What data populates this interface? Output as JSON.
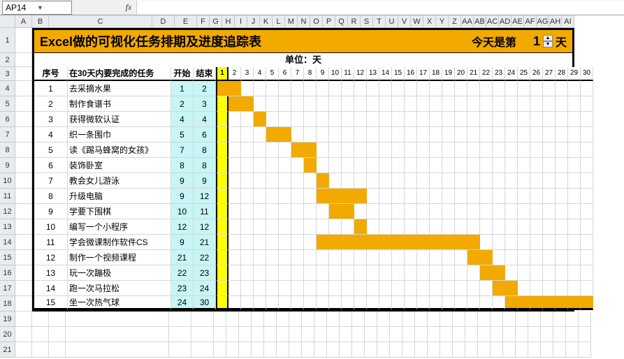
{
  "namebox": "AP14",
  "fx_label": "fx",
  "col_headers": [
    "A",
    "B",
    "C",
    "D",
    "E",
    "F",
    "G",
    "H",
    "I",
    "J",
    "K",
    "L",
    "M",
    "N",
    "O",
    "P",
    "Q",
    "R",
    "S",
    "T",
    "U",
    "V",
    "W",
    "X",
    "Y",
    "Z",
    "AA",
    "AB",
    "AC",
    "AD",
    "AE",
    "AF",
    "AG",
    "AH",
    "AI"
  ],
  "row_headers": [
    "1",
    "2",
    "3",
    "4",
    "5",
    "6",
    "7",
    "8",
    "9",
    "10",
    "11",
    "12",
    "13",
    "14",
    "15",
    "16",
    "17",
    "18",
    "19",
    "20",
    "21"
  ],
  "title": "Excel做的可视化任务排期及进度追踪表",
  "today_label": "今天是第",
  "today_value": "1",
  "today_unit": "天",
  "unit_label": "单位：天",
  "headers": {
    "seq": "序号",
    "task": "在30天内要完成的任务",
    "start": "开始",
    "end": "结束"
  },
  "days": [
    "1",
    "2",
    "3",
    "4",
    "5",
    "6",
    "7",
    "8",
    "9",
    "10",
    "11",
    "12",
    "13",
    "14",
    "15",
    "16",
    "17",
    "18",
    "19",
    "20",
    "21",
    "22",
    "23",
    "24",
    "25",
    "26",
    "27",
    "28",
    "29",
    "30"
  ],
  "today_col": 1,
  "chart_data": {
    "type": "bar",
    "title": "Excel做的可视化任务排期及进度追踪表",
    "xlabel": "天",
    "ylabel": "任务",
    "series": [
      {
        "seq": "1",
        "name": "去采摘水果",
        "start": 1,
        "end": 2
      },
      {
        "seq": "2",
        "name": "制作食谱书",
        "start": 2,
        "end": 3
      },
      {
        "seq": "3",
        "name": "获得微软认证",
        "start": 4,
        "end": 4
      },
      {
        "seq": "4",
        "name": "织一条围巾",
        "start": 5,
        "end": 6
      },
      {
        "seq": "5",
        "name": "读《踢马蜂窝的女孩》",
        "start": 7,
        "end": 8
      },
      {
        "seq": "6",
        "name": "装饰卧室",
        "start": 8,
        "end": 8
      },
      {
        "seq": "7",
        "name": "教会女儿游泳",
        "start": 9,
        "end": 9
      },
      {
        "seq": "8",
        "name": "升级电脑",
        "start": 9,
        "end": 12
      },
      {
        "seq": "9",
        "name": "学要下围棋",
        "start": 10,
        "end": 11
      },
      {
        "seq": "10",
        "name": "编写一个小程序",
        "start": 12,
        "end": 12
      },
      {
        "seq": "11",
        "name": "学会微课制作软件CS",
        "start": 9,
        "end": 21
      },
      {
        "seq": "12",
        "name": "制作一个视频课程",
        "start": 21,
        "end": 22
      },
      {
        "seq": "13",
        "name": "玩一次蹦极",
        "start": 22,
        "end": 23
      },
      {
        "seq": "14",
        "name": "跑一次马拉松",
        "start": 23,
        "end": 24
      },
      {
        "seq": "15",
        "name": "坐一次热气球",
        "start": 24,
        "end": 30
      }
    ],
    "xlim": [
      1,
      30
    ]
  }
}
